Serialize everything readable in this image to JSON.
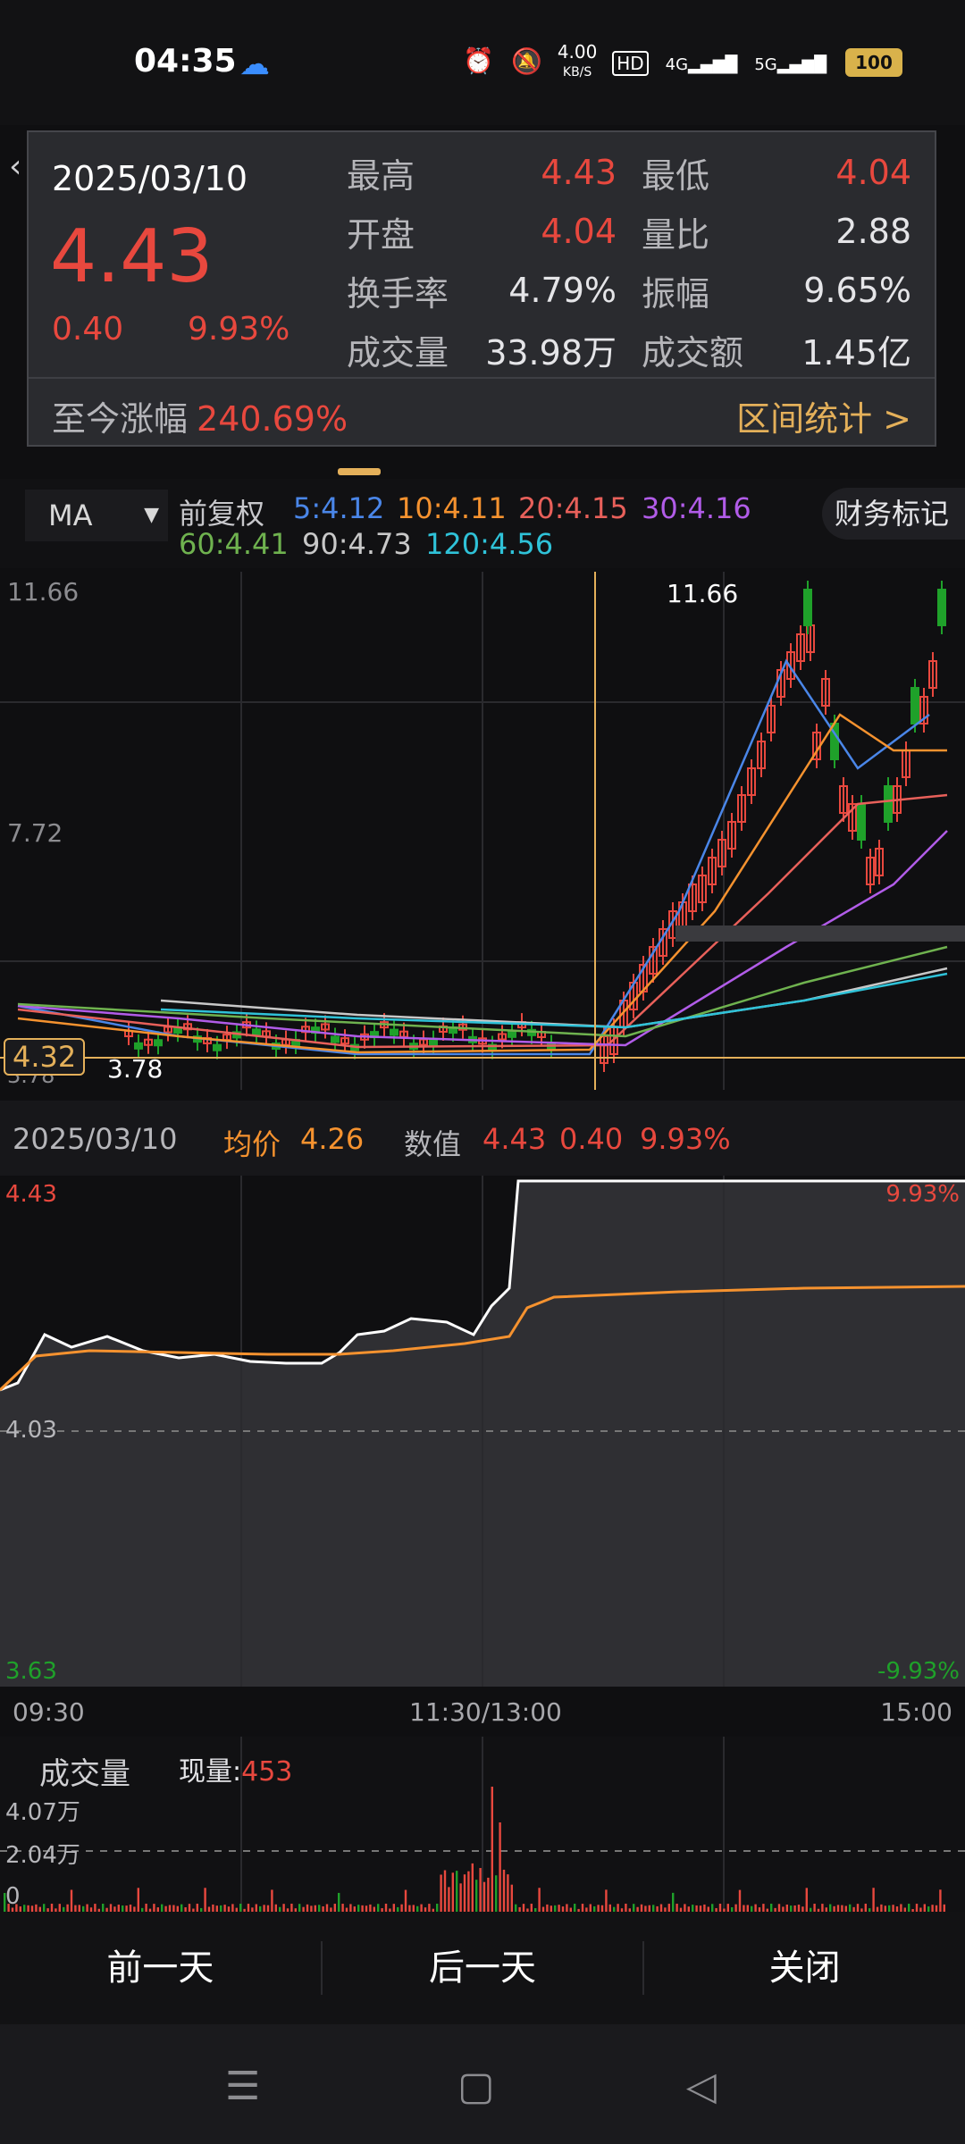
{
  "status": {
    "time": "04:35",
    "net_speed": "4.00",
    "net_unit": "KB/S",
    "hd": "HD",
    "sig4g": "4G",
    "sig5g": "5G",
    "battery": "100"
  },
  "popup": {
    "date": "2025/03/10",
    "price": "4.43",
    "change": "0.40",
    "change_pct": "9.93%",
    "rows": [
      {
        "l1": "最高",
        "v1": "4.43",
        "l2": "最低",
        "v2": "4.04"
      },
      {
        "l1": "开盘",
        "v1": "4.04",
        "l2": "量比",
        "v2": "2.88"
      },
      {
        "l1": "换手率",
        "v1": "4.79%",
        "l2": "振幅",
        "v2": "9.65%"
      },
      {
        "l1": "成交量",
        "v1": "33.98万",
        "l2": "成交额",
        "v2": "1.45亿"
      }
    ],
    "since_label": "至今涨幅",
    "since_value": "240.69%",
    "range_stats": "区间统计 >"
  },
  "ma_bar": {
    "ma_label": "MA",
    "fq": "前复权",
    "ma5": "5:4.12",
    "ma10": "10:4.11",
    "ma20": "20:4.15",
    "ma30": "30:4.16",
    "ma60": "60:4.41",
    "ma90": "90:4.73",
    "ma120": "120:4.56",
    "finance": "财务标记"
  },
  "kline": {
    "y_top": "11.66",
    "y_mid": "7.72",
    "y_low": "3.78",
    "hi_label": "11.66",
    "lo_label": "3.78",
    "cross_price": "4.32"
  },
  "infobar": {
    "date": "2025/03/10",
    "avg_label": "均价",
    "avg": "4.26",
    "val_label": "数值",
    "val": "4.43",
    "chg": "0.40",
    "pct": "9.93%"
  },
  "intraday": {
    "y_top": "4.43",
    "y_mid": "4.03",
    "y_bot": "3.63",
    "pct_top": "9.93%",
    "pct_bot": "-9.93%",
    "t_open": "09:30",
    "t_mid": "11:30/13:00",
    "t_close": "15:00"
  },
  "volume": {
    "title": "成交量",
    "now_label": "现量:",
    "now_value": "453",
    "v1": "4.07万",
    "v2": "2.04万",
    "v0": "0"
  },
  "bottom": {
    "prev": "前一天",
    "next": "后一天",
    "close": "关闭"
  },
  "colors": {
    "up": "#e8483e",
    "down": "#1fa12a",
    "ma5": "#4a86e8",
    "ma10": "#f5922f",
    "ma20": "#e8605a",
    "ma30": "#b15ce8",
    "ma60": "#6fb24f",
    "ma90": "#c8c8c8",
    "ma120": "#2fc2d8",
    "accent": "#e4b05a"
  }
}
